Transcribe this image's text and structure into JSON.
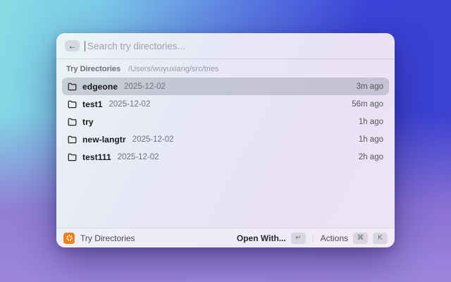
{
  "window": {
    "search": {
      "placeholder": "Search try directories...",
      "back_icon": "←",
      "value": ""
    },
    "section": {
      "title": "Try Directories",
      "path": "/Users/wuyuxiang/src/tries"
    },
    "rows": [
      {
        "name": "edgeone",
        "date": "2025-12-02",
        "time": "3m ago",
        "selected": true
      },
      {
        "name": "test1",
        "date": "2025-12-02",
        "time": "56m ago",
        "selected": false
      },
      {
        "name": "try",
        "date": "",
        "time": "1h ago",
        "selected": false
      },
      {
        "name": "new-langtr",
        "date": "2025-12-02",
        "time": "1h ago",
        "selected": false
      },
      {
        "name": "test111",
        "date": "2025-12-02",
        "time": "2h ago",
        "selected": false
      }
    ],
    "footer": {
      "app_name": "Try Directories",
      "primary_action": "Open With...",
      "primary_key": "↵",
      "divider": "|",
      "secondary_action": "Actions",
      "secondary_key_1": "⌘",
      "secondary_key_2": "K"
    }
  },
  "colors": {
    "accent_orange": "#f08019",
    "bg_top_left": "#87dce4",
    "bg_top_right": "#3a43d6",
    "bg_bottom": "#9b85dc",
    "selection": "rgba(116,121,136,0.30)"
  }
}
